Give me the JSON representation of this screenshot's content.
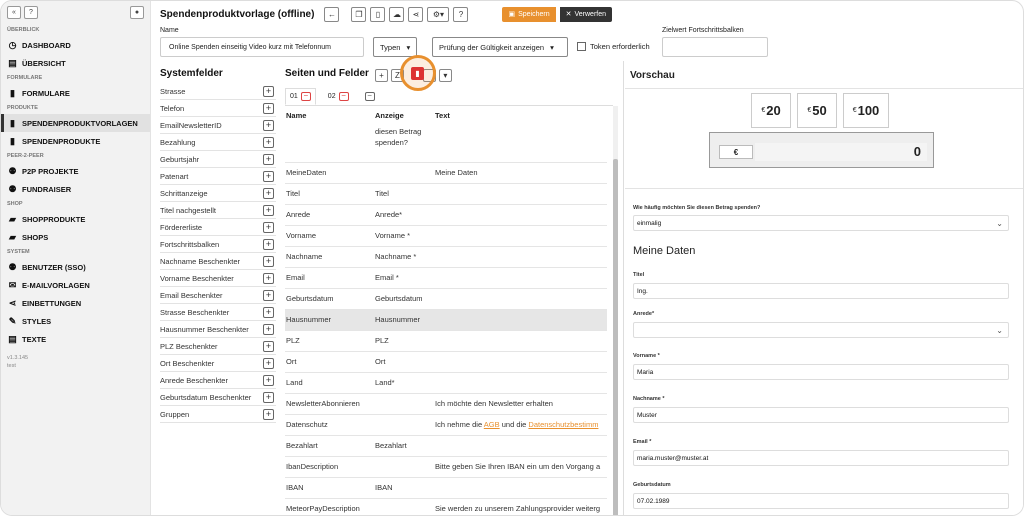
{
  "sidebar": {
    "sections": {
      "overview": "ÜBERBLICK",
      "forms": "FORMULARE",
      "products": "PRODUKTE",
      "p2p": "PEER-2-PEER",
      "shop": "SHOP",
      "system": "SYSTEM"
    },
    "items": {
      "dashboard": "DASHBOARD",
      "uebersicht": "ÜBERSICHT",
      "formulare": "FORMULARE",
      "spendenproduktvorlagen": "SPENDENPRODUKTVORLAGEN",
      "spendenprodukte": "SPENDENPRODUKTE",
      "p2p_projekte": "P2P PROJEKTE",
      "fundraiser": "FUNDRAISER",
      "shopprodukte": "SHOPPRODUKTE",
      "shops": "SHOPS",
      "benutzer": "BENUTZER (SSO)",
      "emailvorlagen": "E-MAILVORLAGEN",
      "einbettungen": "EINBETTUNGEN",
      "styles": "STYLES",
      "texte": "TEXTE"
    },
    "version": "v1.3.145",
    "env": "test"
  },
  "header": {
    "title": "Spendenproduktvorlage (offline)",
    "save_label": "Speichern",
    "discard_label": "Verwerfen",
    "name_label": "Name",
    "name_value": "Online Spenden einseitig Video kurz mit Telefonnum",
    "types_label": "Typen",
    "validity_label": "Prüfung der Gültigkeit anzeigen",
    "token_label": "Token erforderlich",
    "target_label": "Zielwert Fortschrittsbalken",
    "target_value": ""
  },
  "system_fields": {
    "title": "Systemfelder",
    "items": [
      "Strasse",
      "Telefon",
      "EmailNewsletterID",
      "Bezahlung",
      "Geburtsjahr",
      "Patenart",
      "Schrittanzeige",
      "Titel nachgestellt",
      "Fördererliste",
      "Fortschrittsbalken",
      "Nachname Beschenkter",
      "Vorname Beschenkter",
      "Email Beschenkter",
      "Strasse Beschenkter",
      "Hausnummer Beschenkter",
      "PLZ Beschenkter",
      "Ort Beschenkter",
      "Anrede Beschenkter",
      "Geburtsdatum Beschenkter",
      "Gruppen"
    ]
  },
  "pages_fields": {
    "title": "Seiten und Felder",
    "tabs": [
      "01",
      "02"
    ],
    "columns": [
      "Name",
      "Anzeige",
      "Text"
    ],
    "rows": [
      {
        "name": "",
        "display": "diesen Betrag spenden?",
        "text": ""
      },
      {
        "name": "MeineDaten",
        "display": "",
        "text": "Meine Daten"
      },
      {
        "name": "Titel",
        "display": "Titel",
        "text": ""
      },
      {
        "name": "Anrede",
        "display": "Anrede*",
        "text": ""
      },
      {
        "name": "Vorname",
        "display": "Vorname *",
        "text": ""
      },
      {
        "name": "Nachname",
        "display": "Nachname *",
        "text": ""
      },
      {
        "name": "Email",
        "display": "Email *",
        "text": ""
      },
      {
        "name": "Geburtsdatum",
        "display": "Geburtsdatum",
        "text": ""
      },
      {
        "name": "Hausnummer",
        "display": "Hausnummer",
        "text": ""
      },
      {
        "name": "PLZ",
        "display": "PLZ",
        "text": ""
      },
      {
        "name": "Ort",
        "display": "Ort",
        "text": ""
      },
      {
        "name": "Land",
        "display": "Land*",
        "text": ""
      },
      {
        "name": "NewsletterAbonnieren",
        "display": "",
        "text": "Ich möchte den Newsletter erhalten"
      },
      {
        "name": "Datenschutz",
        "display": "",
        "text": "Ich nehme die ",
        "link1": "AGB",
        "mid": " und die ",
        "link2": "Datenschutzbestimm"
      },
      {
        "name": "Bezahlart",
        "display": "Bezahlart",
        "text": ""
      },
      {
        "name": "IbanDescription",
        "display": "",
        "text": "Bitte geben Sie Ihren IBAN ein um den Vorgang a"
      },
      {
        "name": "IBAN",
        "display": "IBAN",
        "text": ""
      },
      {
        "name": "MeteorPayDescription",
        "display": "",
        "text": "Sie werden zu unserem Zahlungsprovider weiterg"
      }
    ]
  },
  "preview": {
    "title": "Vorschau",
    "currency_symbol": "€",
    "amounts": [
      "20",
      "50",
      "100"
    ],
    "custom_currency": "€",
    "custom_value": "0",
    "question_label": "Wie häufig möchten Sie diesen Betrag spenden?",
    "question_value": "einmalig",
    "section_title": "Meine Daten",
    "fields": [
      {
        "label": "Titel",
        "value": "Ing."
      },
      {
        "label": "Anrede*",
        "value": ""
      },
      {
        "label": "Vorname *",
        "value": "Maria"
      },
      {
        "label": "Nachname *",
        "value": "Muster"
      },
      {
        "label": "Email *",
        "value": "maria.muster@muster.at"
      },
      {
        "label": "Geburtsdatum",
        "value": "07.02.1989"
      }
    ]
  },
  "colors": {
    "accent": "#e8902e",
    "danger": "#d33333",
    "dark": "#333333"
  }
}
